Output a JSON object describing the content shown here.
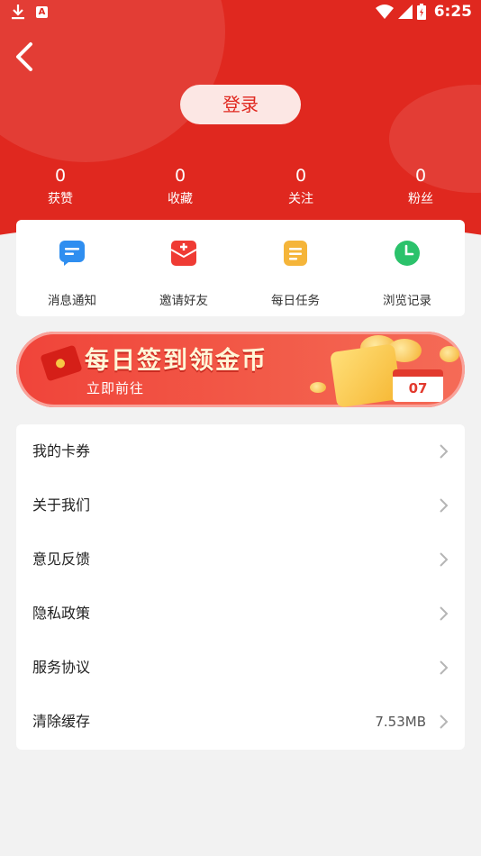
{
  "status_bar": {
    "time": "6:25",
    "left_icons": [
      "download-icon",
      "font-a-icon"
    ],
    "right_icons": [
      "wifi-icon",
      "signal-icon",
      "battery-icon"
    ]
  },
  "header": {
    "back_icon": "chevron-left-icon",
    "login_label": "登录",
    "background_color": "#e0281f"
  },
  "stats": [
    {
      "value": "0",
      "label": "获赞"
    },
    {
      "value": "0",
      "label": "收藏"
    },
    {
      "value": "0",
      "label": "关注"
    },
    {
      "value": "0",
      "label": "粉丝"
    }
  ],
  "quick_actions": [
    {
      "label": "消息通知",
      "icon": "message-icon",
      "color": "#2f8ef0"
    },
    {
      "label": "邀请好友",
      "icon": "invite-envelope-icon",
      "color": "#ef3b34"
    },
    {
      "label": "每日任务",
      "icon": "task-list-icon",
      "color": "#f5b53a"
    },
    {
      "label": "浏览记录",
      "icon": "clock-icon",
      "color": "#2bc26b"
    }
  ],
  "banner": {
    "title": "每日签到领金币",
    "subtitle": "立即前往",
    "calendar_day": "07"
  },
  "menu": [
    {
      "label": "我的卡券",
      "value": ""
    },
    {
      "label": "关于我们",
      "value": ""
    },
    {
      "label": "意见反馈",
      "value": ""
    },
    {
      "label": "隐私政策",
      "value": ""
    },
    {
      "label": "服务协议",
      "value": ""
    },
    {
      "label": "清除缓存",
      "value": "7.53MB"
    }
  ]
}
